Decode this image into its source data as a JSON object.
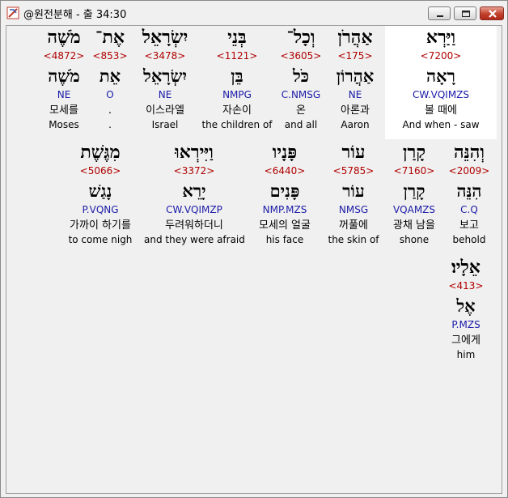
{
  "window": {
    "title": "@원전분해 - 출 34:30"
  },
  "words": [
    {
      "heb": "וַיַּרְא",
      "num": "<7200>",
      "lemma": "רָאָה",
      "parse": "CW.VQIMZS",
      "kor": "볼 때에",
      "eng": "And when - saw"
    },
    {
      "heb": "אַהֲרֹן",
      "num": "<175>",
      "lemma": "אַהֲרוֹן",
      "parse": "NE",
      "kor": "아론과",
      "eng": "Aaron"
    },
    {
      "heb": "וְכָל־",
      "num": "<3605>",
      "lemma": "כֹּל",
      "parse": "C.NMSG",
      "kor": "온",
      "eng": "and all"
    },
    {
      "heb": "בְּנֵי",
      "num": "<1121>",
      "lemma": "בֵּן",
      "parse": "NMPG",
      "kor": "자손이",
      "eng": "the children of"
    },
    {
      "heb": "יִשְׂרָאֵל",
      "num": "<3478>",
      "lemma": "יִשְׂרָאֵל",
      "parse": "NE",
      "kor": "이스라엘",
      "eng": "Israel"
    },
    {
      "heb": "אֶת־",
      "num": "<853>",
      "lemma": "אֵת",
      "parse": "O",
      "kor": ".",
      "eng": "."
    },
    {
      "heb": "מֹשֶׁה",
      "num": "<4872>",
      "lemma": "מֹשֶׁה",
      "parse": "NE",
      "kor": "모세를",
      "eng": "Moses"
    },
    {
      "heb": "וְהִנֵּה",
      "num": "<2009>",
      "lemma": "הִנֵּה",
      "parse": "C.Q",
      "kor": "보고",
      "eng": "behold"
    },
    {
      "heb": "קָרַן",
      "num": "<7160>",
      "lemma": "קָרַן",
      "parse": "VQAMZS",
      "kor": "광채 남을",
      "eng": "shone"
    },
    {
      "heb": "עוֹר",
      "num": "<5785>",
      "lemma": "עוֹר",
      "parse": "NMSG",
      "kor": "꺼풀에",
      "eng": "the skin of"
    },
    {
      "heb": "פָּנָיו",
      "num": "<6440>",
      "lemma": "פָּנִים",
      "parse": "NMP.MZS",
      "kor": "모세의 얼굴",
      "eng": "his face"
    },
    {
      "heb": "וַיִּירְאוּ",
      "num": "<3372>",
      "lemma": "יָרֵא",
      "parse": "CW.VQIMZP",
      "kor": "두려워하더니",
      "eng": "and they were afraid"
    },
    {
      "heb": "מִגֶּשֶׁת",
      "num": "<5066>",
      "lemma": "נָגַשׁ",
      "parse": "P.VQNG",
      "kor": "가까이 하기를",
      "eng": "to come nigh"
    },
    {
      "heb": "אֵלָיו׃",
      "num": "<413>",
      "lemma": "אֶל",
      "parse": "P.MZS",
      "kor": "그에게",
      "eng": "him"
    }
  ]
}
